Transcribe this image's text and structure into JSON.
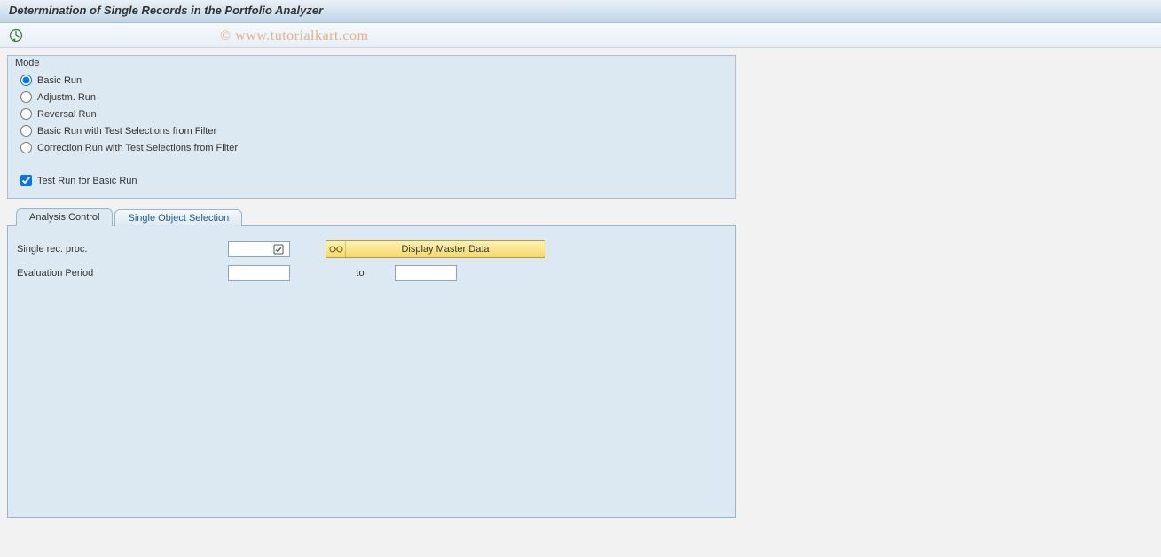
{
  "header": {
    "title": "Determination of Single Records in the Portfolio Analyzer"
  },
  "watermark": "© www.tutorialkart.com",
  "mode": {
    "groupTitle": "Mode",
    "options": {
      "basic": "Basic Run",
      "adjust": "Adjustm. Run",
      "reversal": "Reversal Run",
      "basic_filter": "Basic Run with Test Selections from Filter",
      "correction_filter": "Correction Run with Test Selections from Filter"
    },
    "selected": "basic",
    "testRunLabel": "Test Run for Basic Run",
    "testRunChecked": true
  },
  "tabs": {
    "analysis": "Analysis Control",
    "single_object": "Single Object Selection",
    "active": "analysis"
  },
  "analysis": {
    "singleRecProcLabel": "Single rec. proc.",
    "singleRecProcValue": "",
    "displayMasterDataLabel": "Display Master Data",
    "evalPeriodLabel": "Evaluation Period",
    "evalPeriodFrom": "",
    "evalPeriodToLabel": "to",
    "evalPeriodTo": ""
  }
}
